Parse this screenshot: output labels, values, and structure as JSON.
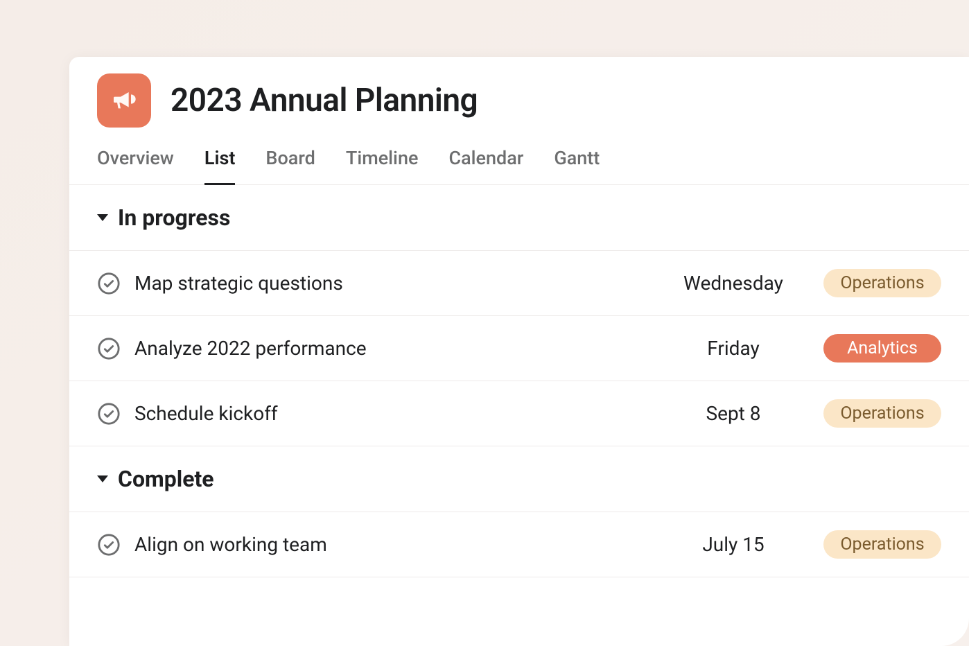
{
  "project": {
    "title": "2023 Annual Planning",
    "icon": "megaphone-icon"
  },
  "tabs": [
    {
      "label": "Overview",
      "active": false
    },
    {
      "label": "List",
      "active": true
    },
    {
      "label": "Board",
      "active": false
    },
    {
      "label": "Timeline",
      "active": false
    },
    {
      "label": "Calendar",
      "active": false
    },
    {
      "label": "Gantt",
      "active": false
    }
  ],
  "sections": [
    {
      "title": "In progress",
      "tasks": [
        {
          "name": "Map strategic questions",
          "date": "Wednesday",
          "tag": {
            "label": "Operations",
            "kind": "operations"
          }
        },
        {
          "name": "Analyze 2022 performance",
          "date": "Friday",
          "tag": {
            "label": "Analytics",
            "kind": "analytics"
          }
        },
        {
          "name": "Schedule kickoff",
          "date": "Sept 8",
          "tag": {
            "label": "Operations",
            "kind": "operations"
          }
        }
      ]
    },
    {
      "title": "Complete",
      "tasks": [
        {
          "name": "Align on working team",
          "date": "July 15",
          "tag": {
            "label": "Operations",
            "kind": "operations"
          }
        }
      ]
    }
  ]
}
